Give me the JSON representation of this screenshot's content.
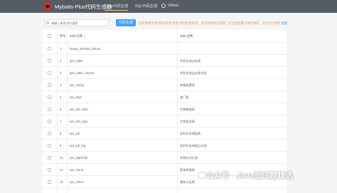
{
  "navbar": {
    "brand": "Mybatis-Plus代码生成器",
    "items": [
      {
        "label": "Table代码生成",
        "active": true
      },
      {
        "label": "SQL代码生成",
        "active": false
      },
      {
        "label": "Github",
        "active": false
      }
    ]
  },
  "toolbar": {
    "search_placeholder": "请输入表名进行搜索",
    "generate_label": "代码生成",
    "tip_text": "选择需要生成代码的表后点击'代码生成'按钮，首次使用请先配置，若当前配置不满足要求，也可自行修改",
    "tip_link": "配置"
  },
  "table": {
    "headers": {
      "index": "序号",
      "table_name": "table名称 ↕",
      "table_comment": "table注释"
    },
    "rows": [
      {
        "index": "1",
        "name": "flyway_schema_history",
        "comment": ""
      },
      {
        "index": "2",
        "name": "gen_table",
        "comment": "代码生成业务表"
      },
      {
        "index": "3",
        "name": "gen_table_column",
        "comment": "代码生成业务表字段"
      },
      {
        "index": "4",
        "name": "sys_config",
        "comment": "参数配置表"
      },
      {
        "index": "5",
        "name": "sys_dept",
        "comment": "部门表"
      },
      {
        "index": "6",
        "name": "sys_dict_data",
        "comment": "字典数据表"
      },
      {
        "index": "7",
        "name": "sys_dict_type",
        "comment": "字典类型表"
      },
      {
        "index": "8",
        "name": "sys_job",
        "comment": "定时任务调度表"
      },
      {
        "index": "9",
        "name": "sys_job_log",
        "comment": "定时任务调度日志表"
      },
      {
        "index": "10",
        "name": "sys_logininfor",
        "comment": "系统访问记录"
      },
      {
        "index": "11",
        "name": "sys_menu",
        "comment": "菜单权限表"
      },
      {
        "index": "12",
        "name": "sys_notice",
        "comment": "通知公告表"
      }
    ]
  },
  "watermark": "公众号 · Java面试题精选",
  "colors": {
    "navbar": "#545c64",
    "primary": "#409eff",
    "warning": "#e6a23c",
    "active_underline": "#ffd04b"
  }
}
